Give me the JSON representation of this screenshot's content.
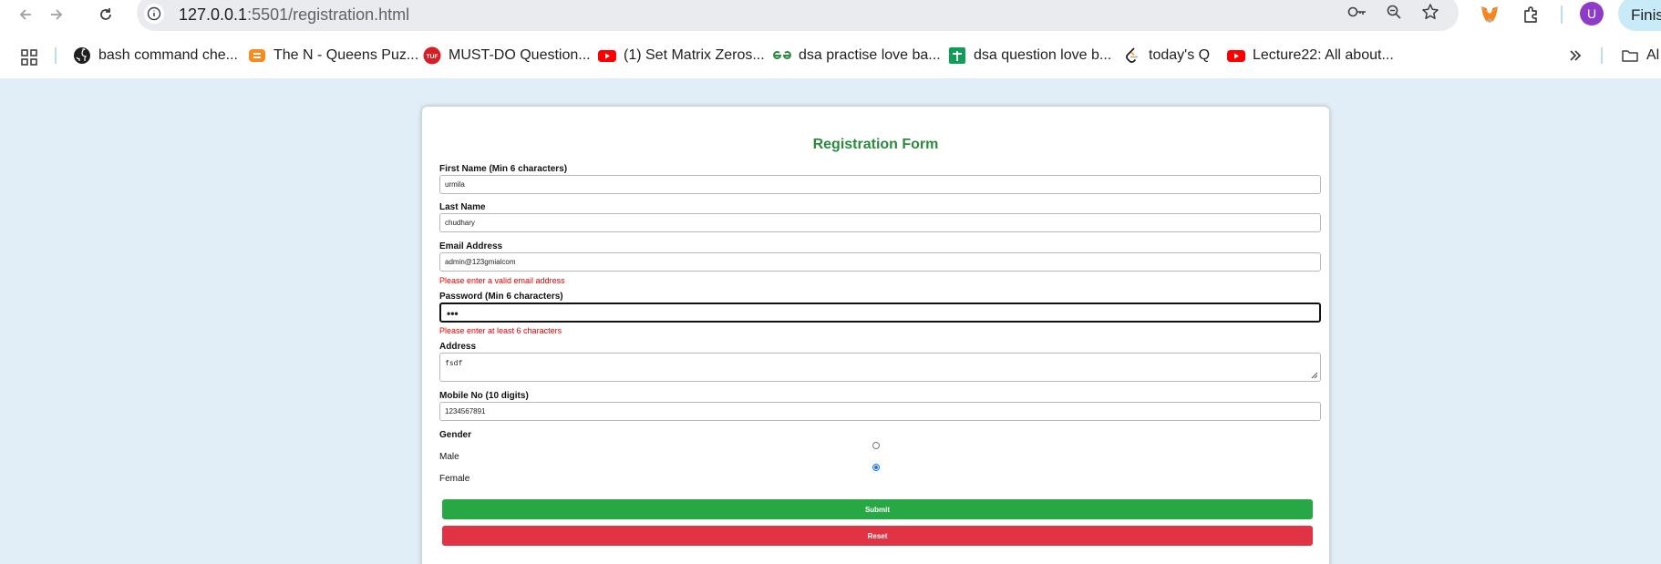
{
  "browser": {
    "url_host": "127.0.0.1",
    "url_rest": ":5501/registration.html",
    "finish_label": "Finish",
    "avatar_letter": "U",
    "bookmarks": [
      {
        "label": "bash command che...",
        "icon": "github-icon"
      },
      {
        "label": "The N - Queens Puz...",
        "icon": "codingninjas-icon"
      },
      {
        "label": "MUST-DO Question...",
        "icon": "tuf-icon"
      },
      {
        "label": "(1) Set Matrix Zeros...",
        "icon": "youtube-icon"
      },
      {
        "label": "dsa practise love ba...",
        "icon": "gfg-icon"
      },
      {
        "label": "dsa question love b...",
        "icon": "sheets-icon"
      },
      {
        "label": "today's Q",
        "icon": "leetcode-icon"
      },
      {
        "label": "Lecture22: All about...",
        "icon": "youtube-icon"
      }
    ],
    "all_bookmarks_label": "Al"
  },
  "form": {
    "title": "Registration Form",
    "first_name": {
      "label": "First Name (Min 6 characters)",
      "value": "urmila"
    },
    "last_name": {
      "label": "Last Name",
      "value": "chudhary"
    },
    "email": {
      "label": "Email Address",
      "value": "admin@123gmialcom",
      "error": "Please enter a valid email address"
    },
    "password": {
      "label": "Password (Min 6 characters)",
      "masked_value": "•••",
      "error": "Please enter at least 6 characters"
    },
    "address": {
      "label": "Address",
      "value": "fsdf"
    },
    "mobile": {
      "label": "Mobile No (10 digits)",
      "value": "1234567891"
    },
    "gender": {
      "label": "Gender",
      "options": [
        "Male",
        "Female"
      ],
      "selected": "Female"
    },
    "submit_label": "Submit",
    "reset_label": "Reset"
  },
  "colors": {
    "title_green": "#2c8a3e",
    "submit_green": "#28a745",
    "reset_red": "#e03444",
    "error_red": "#e60000",
    "page_bg": "#e1eef7"
  }
}
